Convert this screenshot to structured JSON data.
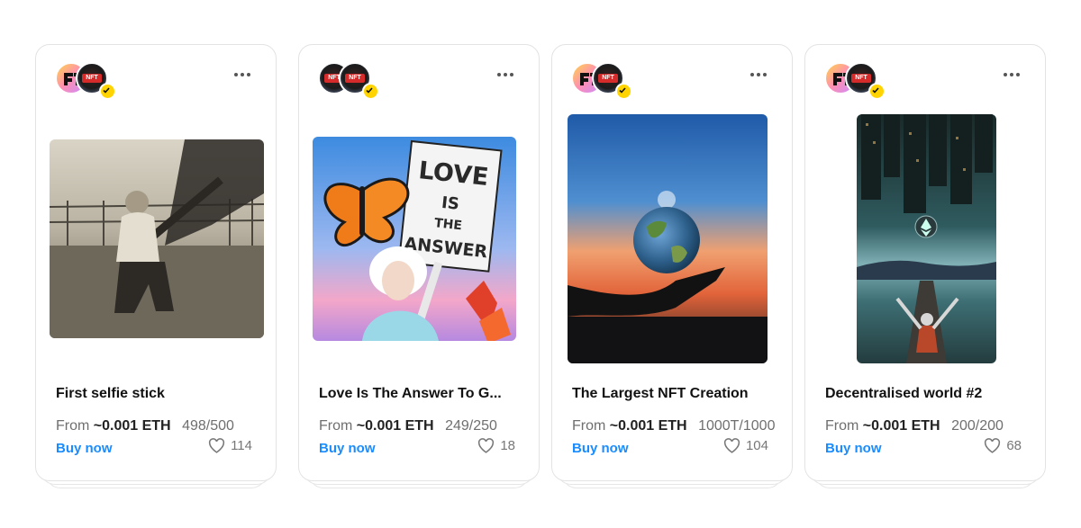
{
  "cards": [
    {
      "title": "First selfie stick",
      "from_label": "From",
      "price": "~0.001 ETH",
      "edition": "498/500",
      "buy_label": "Buy now",
      "likes": "114"
    },
    {
      "title": "Love Is The Answer To G...",
      "from_label": "From",
      "price": "~0.001 ETH",
      "edition": "249/250",
      "buy_label": "Buy now",
      "likes": "18",
      "sign_text": [
        "LOVE",
        "IS",
        "THE",
        "ANSWER"
      ]
    },
    {
      "title": "The Largest NFT Creation",
      "from_label": "From",
      "price": "~0.001 ETH",
      "edition": "1000T/1000",
      "buy_label": "Buy now",
      "likes": "104"
    },
    {
      "title": "Decentralised world #2",
      "from_label": "From",
      "price": "~0.001 ETH",
      "edition": "200/200",
      "buy_label": "Buy now",
      "likes": "68"
    }
  ],
  "avatar_badge_text": "NFT",
  "colors": {
    "buy_link": "#1a8cff",
    "verified_badge": "#ffd400"
  },
  "icons": {
    "more": "more-horizontal-icon",
    "like": "heart-icon",
    "verified": "check-icon"
  }
}
